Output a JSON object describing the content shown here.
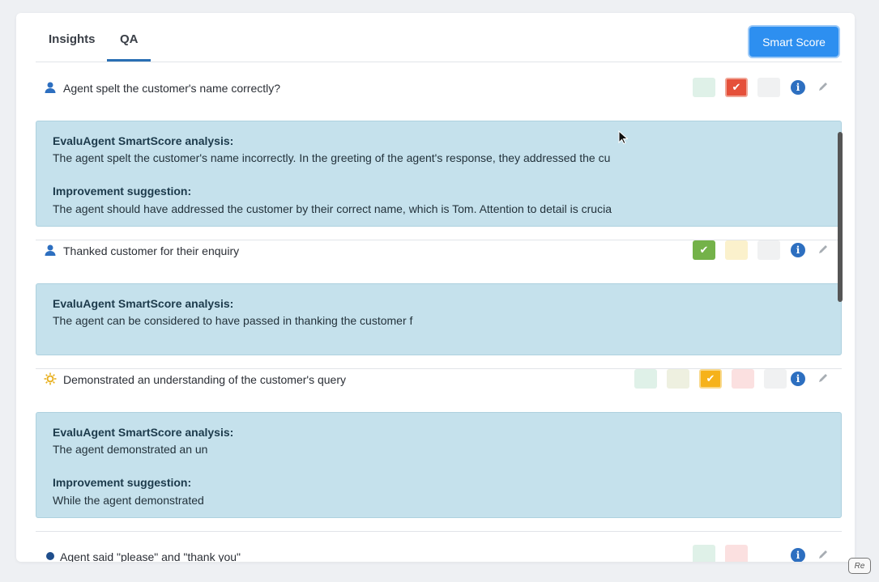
{
  "tabs": [
    {
      "label": "Insights"
    },
    {
      "label": "QA"
    }
  ],
  "active_tab": "QA",
  "smart_score_button": "Smart Score",
  "items": [
    {
      "title": "Agent spelt the customer's name correctly?",
      "type_icon": "user-icon",
      "analysis_label": "EvaluAgent SmartScore analysis:",
      "analysis_text": "The agent spelt the customer's name incorrectly. In the greeting of the agent's response, they addressed the cu",
      "suggestion_label": "Improvement suggestion:",
      "suggestion_text": "The agent should have addressed the customer by their correct name, which is Tom. Attention to detail is crucia"
    },
    {
      "title": "Thanked customer for their enquiry",
      "type_icon": "user-icon",
      "analysis_label": "EvaluAgent SmartScore analysis:",
      "analysis_text": "The agent can be considered to have passed in thanking the customer f"
    },
    {
      "title": "Demonstrated an understanding of the customer's query",
      "type_icon": "sun-icon",
      "analysis_label": "EvaluAgent SmartScore analysis:",
      "analysis_text": "The agent demonstrated an un",
      "suggestion_label": "Improvement suggestion:",
      "suggestion_text": "While the agent demonstrated"
    },
    {
      "title": "Agent said \"please\" and \"thank you\"",
      "type_icon": "dot-icon"
    }
  ],
  "colors": {
    "accent": "#2d8ff0",
    "tab_active": "#2a6fb4",
    "panel_bg": "#c5e1ec",
    "fail_red": "#e5503a",
    "pass_green": "#74b249",
    "partial_yellow": "#f6b21a"
  },
  "watermark": "Re"
}
